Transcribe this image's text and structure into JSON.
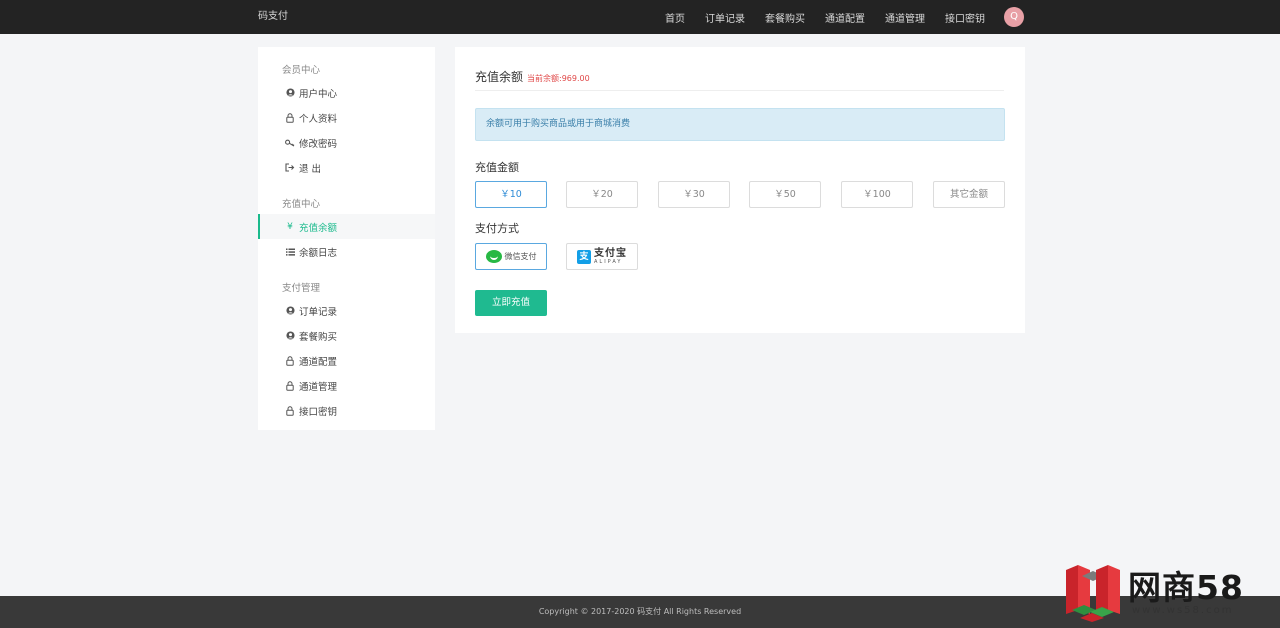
{
  "header": {
    "brand": "码支付",
    "nav": [
      "首页",
      "订单记录",
      "套餐购买",
      "通道配置",
      "通道管理",
      "接口密钥"
    ],
    "avatar_letter": "Q"
  },
  "sidebar": {
    "groups": [
      {
        "title": "会员中心",
        "items": [
          "用户中心",
          "个人资料",
          "修改密码",
          "退 出"
        ]
      },
      {
        "title": "充值中心",
        "items": [
          "充值余额",
          "余额日志"
        ]
      },
      {
        "title": "支付管理",
        "items": [
          "订单记录",
          "套餐购买",
          "通道配置",
          "通道管理",
          "接口密钥"
        ]
      }
    ],
    "active_item": "充值余额"
  },
  "main": {
    "title": "充值余额",
    "balance": "当前余额:969.00",
    "notice": "余额可用于购买商品或用于商城消费",
    "amount_label": "充值金额",
    "amounts": [
      "￥10",
      "￥20",
      "￥30",
      "￥50",
      "￥100",
      "其它金额"
    ],
    "selected_amount": 0,
    "payment_label": "支付方式",
    "payments": {
      "wechat": "微信支付",
      "alipay_cn": "支付宝",
      "alipay_en": "ALIPAY"
    },
    "submit": "立即充值"
  },
  "footer": {
    "copyright": "Copyright © 2017-2020 码支付 All Rights Reserved"
  },
  "watermark": {
    "text": "网商58",
    "url": "www.ws58.com"
  },
  "colors": {
    "accent": "#1aba8c",
    "topbar": "#232323",
    "footer": "#393939",
    "balance": "#e04848",
    "selected_border": "#5aa8e0"
  }
}
